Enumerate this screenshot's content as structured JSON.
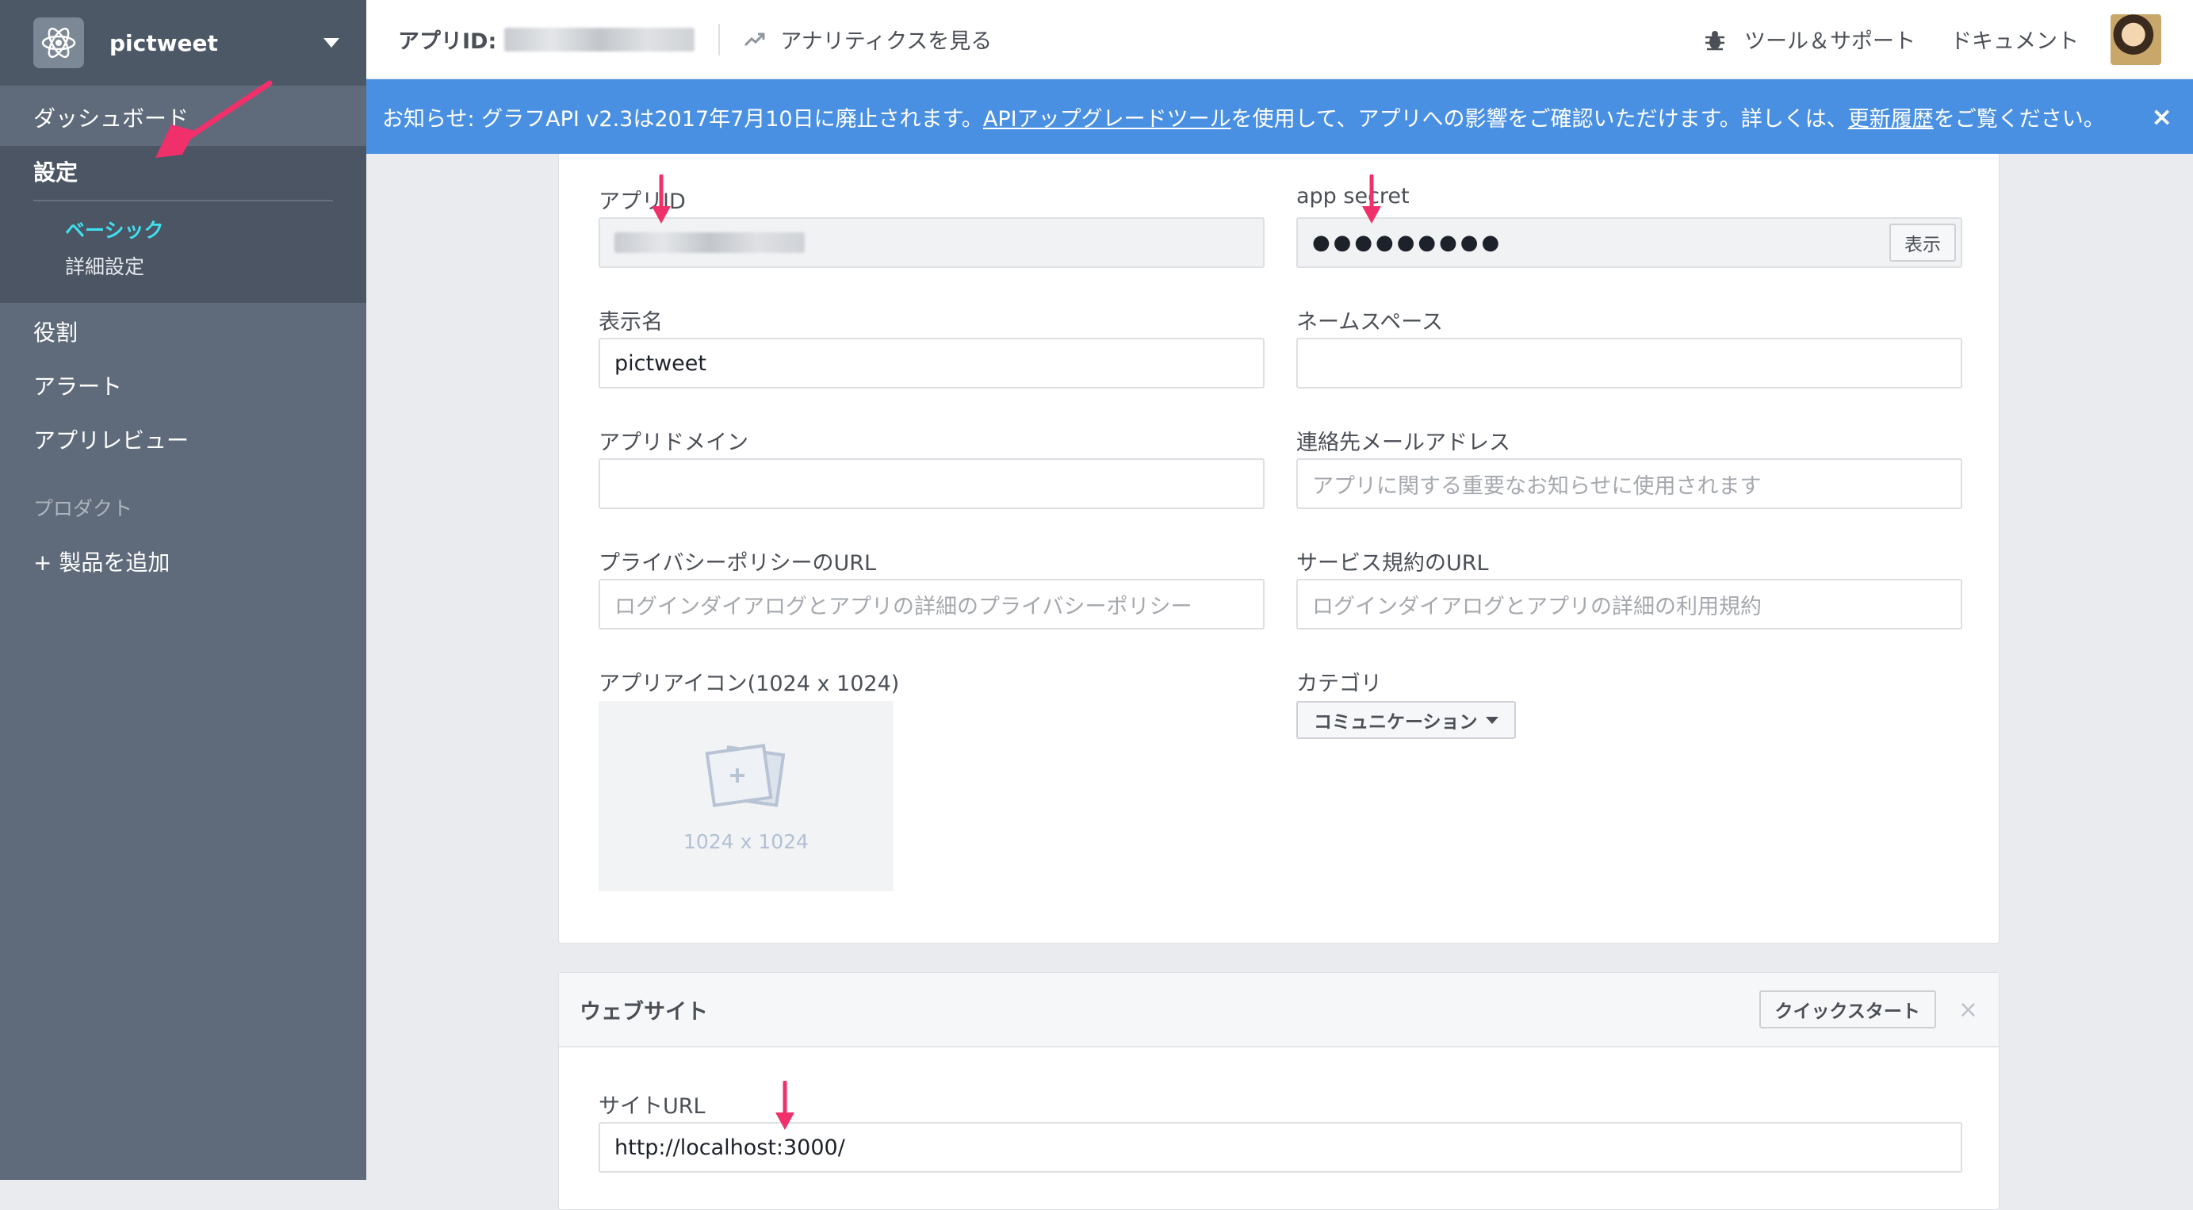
{
  "app": {
    "name": "pictweet"
  },
  "sidebar": {
    "items": [
      {
        "label": "ダッシュボード"
      },
      {
        "label": "設定"
      },
      {
        "label": "役割"
      },
      {
        "label": "アラート"
      },
      {
        "label": "アプリレビュー"
      }
    ],
    "settings_sub": [
      {
        "label": "ベーシック"
      },
      {
        "label": "詳細設定"
      }
    ],
    "section_products": "プロダクト",
    "add_product": "+ 製品を追加"
  },
  "topbar": {
    "app_id_label": "アプリID:",
    "analytics": "アナリティクスを見る",
    "tools": "ツール＆サポート",
    "docs": "ドキュメント"
  },
  "notice": {
    "prefix": "お知らせ: グラフAPI v2.3は2017年7月10日に廃止されます。",
    "link1": "APIアップグレードツール",
    "middle": "を使用して、アプリへの影響をご確認いただけます。詳しくは、",
    "link2": "更新履歴",
    "suffix": "をご覧ください。",
    "close": "×"
  },
  "basic": {
    "app_id_label": "アプリID",
    "app_secret_label": "app secret",
    "app_secret_value": "●●●●●●●●●",
    "show_button": "表示",
    "display_name_label": "表示名",
    "display_name_value": "pictweet",
    "namespace_label": "ネームスペース",
    "app_domain_label": "アプリドメイン",
    "contact_email_label": "連絡先メールアドレス",
    "contact_email_placeholder": "アプリに関する重要なお知らせに使用されます",
    "privacy_label": "プライバシーポリシーのURL",
    "privacy_placeholder": "ログインダイアログとアプリの詳細のプライバシーポリシー",
    "tos_label": "サービス規約のURL",
    "tos_placeholder": "ログインダイアログとアプリの詳細の利用規約",
    "icon_label": "アプリアイコン(1024 x 1024)",
    "icon_size": "1024 x 1024",
    "category_label": "カテゴリ",
    "category_value": "コミュニケーション"
  },
  "website": {
    "title": "ウェブサイト",
    "quickstart": "クイックスタート",
    "close": "×",
    "site_url_label": "サイトURL",
    "site_url_value": "http://localhost:3000/"
  },
  "colors": {
    "sidebar_bg": "#5f6b7a",
    "notice_bg": "#4a90e2",
    "active_sub": "#40e0f0",
    "annotation_arrow": "#f0306a"
  }
}
